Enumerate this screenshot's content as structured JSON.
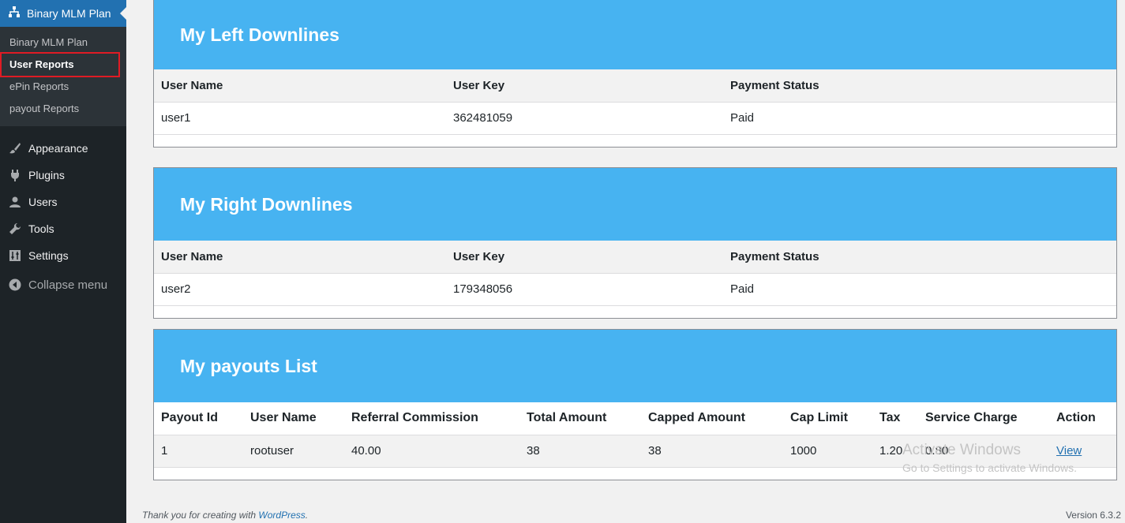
{
  "sidebar": {
    "top": {
      "label": "Binary MLM Plan",
      "icon": "sitemap-icon"
    },
    "submenu": [
      {
        "label": "Binary MLM Plan"
      },
      {
        "label": "User Reports"
      },
      {
        "label": "ePin Reports"
      },
      {
        "label": "payout Reports"
      }
    ],
    "items": [
      {
        "label": "Appearance",
        "icon": "paintbrush-icon"
      },
      {
        "label": "Plugins",
        "icon": "plug-icon"
      },
      {
        "label": "Users",
        "icon": "user-icon"
      },
      {
        "label": "Tools",
        "icon": "wrench-icon"
      },
      {
        "label": "Settings",
        "icon": "sliders-icon"
      }
    ],
    "collapse": {
      "label": "Collapse menu",
      "icon": "collapse-icon"
    }
  },
  "left_downlines": {
    "title": "My Left Downlines",
    "headers": [
      "User Name",
      "User Key",
      "Payment Status"
    ],
    "rows": [
      [
        "user1",
        "362481059",
        "Paid"
      ]
    ]
  },
  "right_downlines": {
    "title": "My Right Downlines",
    "headers": [
      "User Name",
      "User Key",
      "Payment Status"
    ],
    "rows": [
      [
        "user2",
        "179348056",
        "Paid"
      ]
    ]
  },
  "payouts": {
    "title": "My payouts List",
    "headers": [
      "Payout Id",
      "User Name",
      "Referral Commission",
      "Total Amount",
      "Capped Amount",
      "Cap Limit",
      "Tax",
      "Service Charge",
      "Action"
    ],
    "rows": [
      [
        "1",
        "rootuser",
        "40.00",
        "38",
        "38",
        "1000",
        "1.20",
        "0.80",
        "View"
      ]
    ]
  },
  "watermark": {
    "line1": "Activate Windows",
    "line2": "Go to Settings to activate Windows."
  },
  "footer": {
    "thanks": "Thank you for creating with ",
    "link": "WordPress",
    "period": ".",
    "version": "Version 6.3.2"
  },
  "colors": {
    "accent": "#2271b1",
    "panel_header": "#47b3f1",
    "sidebar": "#1d2327",
    "highlight_box": "#e01b24"
  }
}
